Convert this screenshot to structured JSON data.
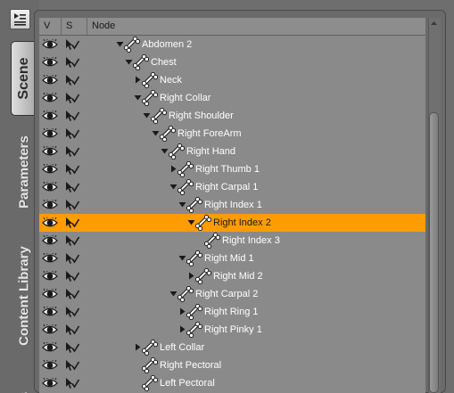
{
  "tabs": {
    "scene": "Scene",
    "parameters": "Parameters",
    "content_library": "Content Library",
    "extra": "s"
  },
  "header": {
    "visible_col": "V",
    "selectable_col": "S",
    "node_col": "Node"
  },
  "tree": [
    {
      "label": "Abdomen 2",
      "depth": 0,
      "expander": "expanded",
      "selected": false
    },
    {
      "label": "Chest",
      "depth": 1,
      "expander": "expanded",
      "selected": false
    },
    {
      "label": "Neck",
      "depth": 2,
      "expander": "collapsed",
      "selected": false
    },
    {
      "label": "Right Collar",
      "depth": 2,
      "expander": "expanded",
      "selected": false
    },
    {
      "label": "Right Shoulder",
      "depth": 3,
      "expander": "expanded",
      "selected": false
    },
    {
      "label": "Right ForeArm",
      "depth": 4,
      "expander": "expanded",
      "selected": false
    },
    {
      "label": "Right Hand",
      "depth": 5,
      "expander": "expanded",
      "selected": false
    },
    {
      "label": "Right Thumb 1",
      "depth": 6,
      "expander": "collapsed",
      "selected": false
    },
    {
      "label": "Right Carpal 1",
      "depth": 6,
      "expander": "expanded",
      "selected": false
    },
    {
      "label": "Right Index 1",
      "depth": 7,
      "expander": "expanded",
      "selected": false
    },
    {
      "label": "Right Index 2",
      "depth": 8,
      "expander": "expanded",
      "selected": true
    },
    {
      "label": "Right Index 3",
      "depth": 9,
      "expander": "none",
      "selected": false
    },
    {
      "label": "Right Mid 1",
      "depth": 7,
      "expander": "expanded",
      "selected": false
    },
    {
      "label": "Right Mid 2",
      "depth": 8,
      "expander": "collapsed",
      "selected": false
    },
    {
      "label": "Right Carpal 2",
      "depth": 6,
      "expander": "expanded",
      "selected": false
    },
    {
      "label": "Right Ring 1",
      "depth": 7,
      "expander": "collapsed",
      "selected": false
    },
    {
      "label": "Right Pinky 1",
      "depth": 7,
      "expander": "collapsed",
      "selected": false
    },
    {
      "label": "Left Collar",
      "depth": 2,
      "expander": "collapsed",
      "selected": false
    },
    {
      "label": "Right Pectoral",
      "depth": 2,
      "expander": "none",
      "selected": false
    },
    {
      "label": "Left Pectoral",
      "depth": 2,
      "expander": "none",
      "selected": false
    }
  ],
  "colors": {
    "selection": "#ff9c00",
    "tree_background": "#8a8a8a",
    "label_text": "#ffffff"
  },
  "icons": {
    "row_visible": "eye-icon",
    "row_selectable": "cursor-check-icon",
    "node_type": "bone-icon",
    "menu": "panel-menu-icon"
  }
}
